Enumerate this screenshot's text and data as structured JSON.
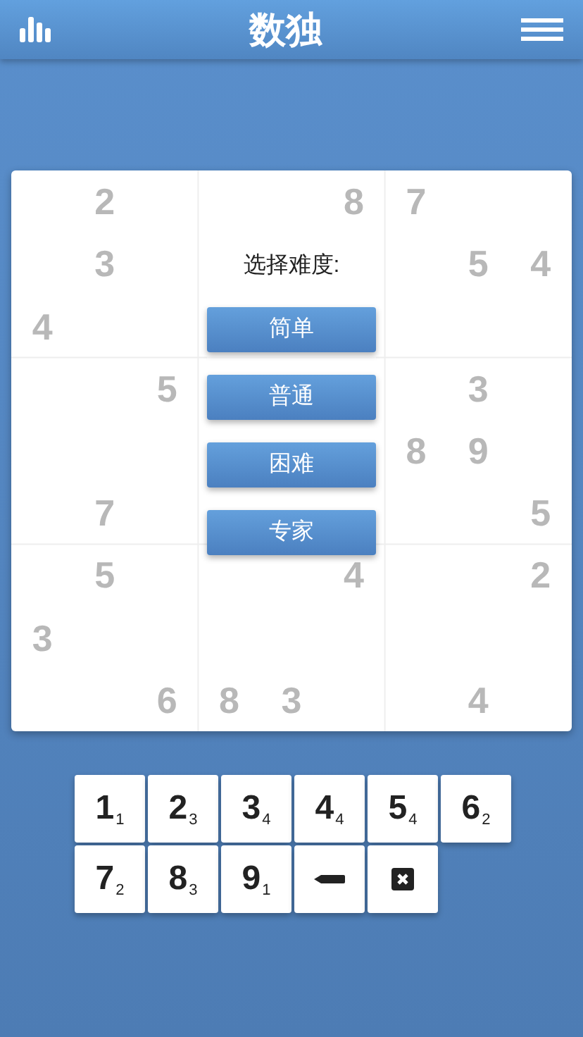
{
  "header": {
    "title": "数独"
  },
  "board": {
    "rows": [
      [
        null,
        "2",
        null,
        null,
        null,
        "8",
        "7",
        null,
        null
      ],
      [
        null,
        "3",
        null,
        null,
        null,
        null,
        null,
        "5",
        "4"
      ],
      [
        "4",
        null,
        null,
        null,
        null,
        null,
        null,
        null,
        null
      ],
      [
        null,
        null,
        "5",
        null,
        null,
        null,
        null,
        "3",
        null
      ],
      [
        null,
        null,
        null,
        null,
        null,
        null,
        "8",
        "9",
        null
      ],
      [
        null,
        "7",
        null,
        null,
        null,
        null,
        null,
        null,
        "5"
      ],
      [
        null,
        "5",
        null,
        null,
        null,
        "4",
        null,
        null,
        "2"
      ],
      [
        "3",
        null,
        null,
        null,
        null,
        null,
        null,
        null,
        null
      ],
      [
        null,
        null,
        "6",
        "8",
        "3",
        null,
        null,
        "4",
        null
      ]
    ]
  },
  "dialog": {
    "prompt": "选择难度:",
    "options": [
      "简单",
      "普通",
      "困难",
      "专家"
    ]
  },
  "keypad": [
    {
      "kind": "digit",
      "digit": "1",
      "count": "1"
    },
    {
      "kind": "digit",
      "digit": "2",
      "count": "3"
    },
    {
      "kind": "digit",
      "digit": "3",
      "count": "4"
    },
    {
      "kind": "digit",
      "digit": "4",
      "count": "4"
    },
    {
      "kind": "digit",
      "digit": "5",
      "count": "4"
    },
    {
      "kind": "digit",
      "digit": "6",
      "count": "2"
    },
    {
      "kind": "digit",
      "digit": "7",
      "count": "2"
    },
    {
      "kind": "digit",
      "digit": "8",
      "count": "3"
    },
    {
      "kind": "digit",
      "digit": "9",
      "count": "1"
    },
    {
      "kind": "pencil"
    },
    {
      "kind": "erase"
    }
  ]
}
